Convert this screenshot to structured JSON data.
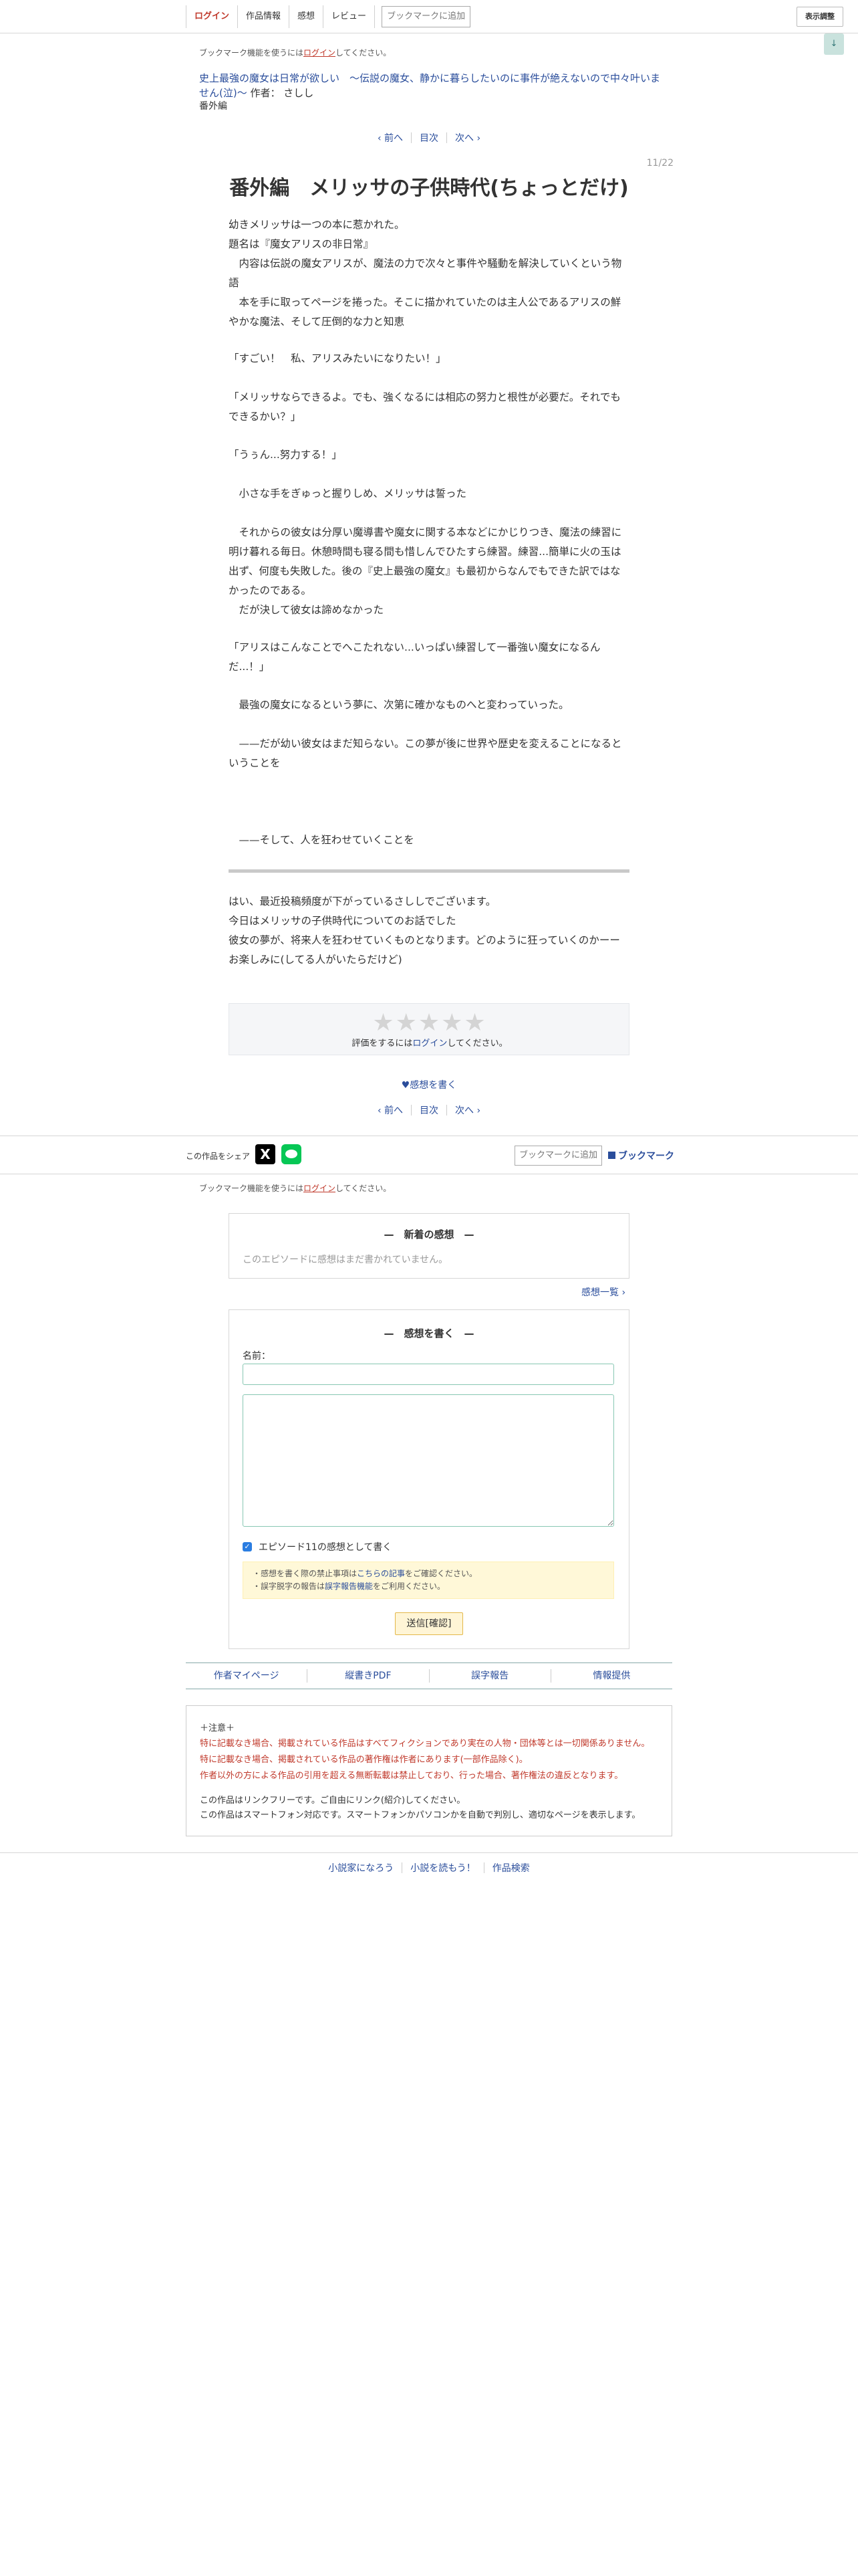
{
  "header": {
    "login": "ログイン",
    "nav": [
      "作品情報",
      "感想",
      "レビュー"
    ],
    "bookmark_add": "ブックマークに追加",
    "display_settings": "表示調整",
    "scroll_arrow": "↓"
  },
  "notice": {
    "prefix": "ブックマーク機能を使うには",
    "login": "ログイン",
    "suffix": "してください。"
  },
  "novel": {
    "title": "史上最強の魔女は日常が欲しい　〜伝説の魔女、静かに暮らしたいのに事件が絶えないので中々叶いません(泣)〜",
    "author_label": "作者：",
    "author": "さしし",
    "category": "番外編"
  },
  "pager": {
    "prev": "‹ 前へ",
    "toc": "目次",
    "next": "次へ ›"
  },
  "episode": {
    "number": "11/22",
    "title": "番外編　メリッサの子供時代(ちょっとだけ)"
  },
  "body": {
    "paragraphs": [
      "幼きメリッサは一つの本に惹かれた。\n題名は『魔女アリスの非日常』\n　内容は伝説の魔女アリスが、魔法の力で次々と事件や騒動を解決していくという物語\n　本を手に取ってページを捲った。そこに描かれていたのは主人公であるアリスの鮮やかな魔法、そして圧倒的な力と知恵",
      "「すごい！　私、アリスみたいになりたい！」",
      "「メリッサならできるよ。でも、強くなるには相応の努力と根性が必要だ。それでもできるかい？」",
      "「うぅん...努力する！」",
      "　小さな手をぎゅっと握りしめ、メリッサは誓った",
      "　それからの彼女は分厚い魔導書や魔女に関する本などにかじりつき、魔法の練習に明け暮れる毎日。休憩時間も寝る間も惜しんでひたすら練習。練習...簡単に火の玉は出ず、何度も失敗した。後の『史上最強の魔女』も最初からなんでもできた訳ではなかったのである。\n　だが決して彼女は諦めなかった",
      "「アリスはこんなことでへこたれない...いっぱい練習して一番強い魔女になるんだ...！」",
      "　最強の魔女になるという夢に、次第に確かなものへと変わっていった。",
      "　——だが幼い彼女はまだ知らない。この夢が後に世界や歴史を変えることになるということを",
      "　——そして、人を狂わせていくことを"
    ],
    "afterword": "はい、最近投稿頻度が下がっているさししでございます。\n今日はメリッサの子供時代についてのお話でした\n彼女の夢が、将来人を狂わせていくものとなります。どのように狂っていくのかーーお楽しみに(してる人がいたらだけど)"
  },
  "rating": {
    "stars": "★★★★★",
    "prefix": "評価をするには",
    "login": "ログイン",
    "suffix": "してください。"
  },
  "write_impression_link": "♥感想を書く",
  "share": {
    "label": "この作品をシェア",
    "x_icon": "X",
    "bookmark_add": "ブックマークに追加",
    "bookmark": "ブックマーク"
  },
  "latest": {
    "title": "—　新着の感想　—",
    "empty": "このエピソードに感想はまだ書かれていません。",
    "more": "感想一覧 ›"
  },
  "form": {
    "title": "—　感想を書く　—",
    "name_label": "名前：",
    "name_value": "",
    "body_value": "",
    "checkbox_label": "エピソード11の感想として書く",
    "note_line1_prefix": "・感想を書く際の禁止事項は",
    "note_line1_link": "こちらの記事",
    "note_line1_suffix": "をご確認ください。",
    "note_line2_prefix": "・誤字脱字の報告は",
    "note_line2_link": "誤字報告機能",
    "note_line2_suffix": "をご利用ください。",
    "submit": "送信[確認]"
  },
  "footer_nav": [
    "作者マイページ",
    "縦書きPDF",
    "誤字報告",
    "情報提供"
  ],
  "caution": {
    "title": "＋注意＋",
    "red1": "特に記載なき場合、掲載されている作品はすべてフィクションであり実在の人物・団体等とは一切関係ありません。",
    "red2": "特に記載なき場合、掲載されている作品の著作権は作者にあります(一部作品除く)。",
    "red3": "作者以外の方による作品の引用を超える無断転載は禁止しており、行った場合、著作権法の違反となります。",
    "gray1": "この作品はリンクフリーです。ご自由にリンク(紹介)してください。",
    "gray2": "この作品はスマートフォン対応です。スマートフォンかパソコンかを自動で判別し、適切なページを表示します。"
  },
  "bottom": [
    "小説家になろう",
    "小説を読もう！",
    "作品検索"
  ],
  "colors": {
    "link": "#2a4d9b",
    "login": "#c0392b",
    "caution_red": "#c0392b"
  }
}
